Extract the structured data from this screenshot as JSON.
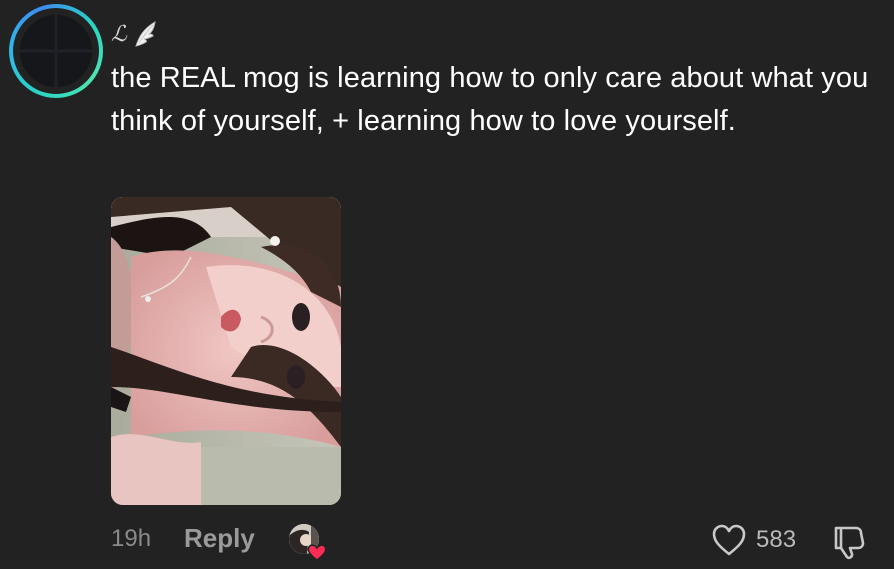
{
  "comment": {
    "author_display": "ℒ",
    "author_emoji_icon": "wing-icon",
    "text": "the REAL mog is learning how to only care about what you think of yourself, + learning how to love yourself.",
    "photo_description_icon": "selfie-photo",
    "timestamp": "19h",
    "reply_label": "Reply",
    "like_count": "583",
    "liked_by_creator": true
  },
  "icons": {
    "like": "heart-outline-icon",
    "dislike": "thumbs-down-icon",
    "creator_heart": "heart-icon"
  },
  "colors": {
    "background": "#222222",
    "avatar_ring": "#2fb7e8",
    "text": "#ffffff",
    "muted": "#8a8a8a",
    "heart_badge": "#fe2c55"
  }
}
